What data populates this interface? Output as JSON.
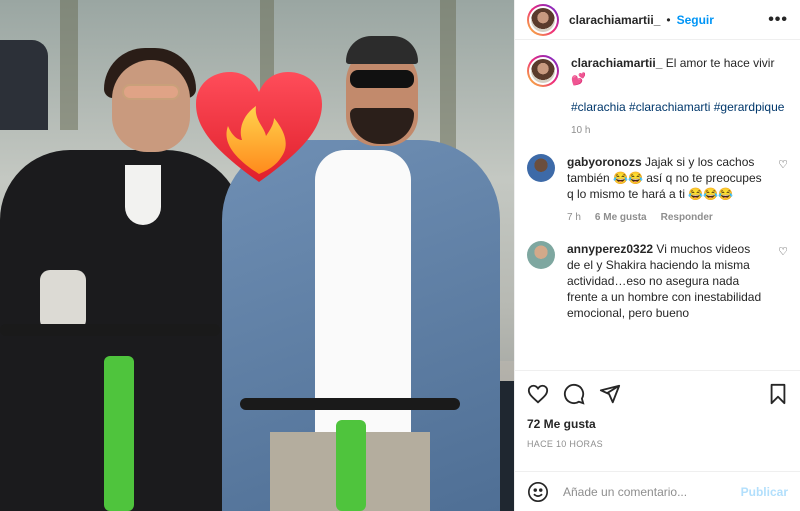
{
  "post": {
    "username": "clarachiamartii_",
    "follow_label": "Seguir",
    "more_label": "•••",
    "caption_text": "El amor te hace vivir",
    "caption_emoji": "💕",
    "hashtags": "#clarachia #clarachiamarti #gerardpique",
    "caption_time": "10 h",
    "heart_emoji_name": "heart-on-fire-icon"
  },
  "comments": [
    {
      "username": "gabyoronozs",
      "text": "Jajak si y los cachos también 😂😂 así q no te preocupes q lo mismo te hará a ti 😂😂😂",
      "time": "7 h",
      "likes": "6 Me gusta",
      "reply_label": "Responder"
    },
    {
      "username": "annyperez0322",
      "text": "Vi muchos videos de el y Shakira haciendo la misma actividad…eso no asegura nada frente a un hombre con inestabilidad emocional, pero bueno"
    }
  ],
  "stats": {
    "likes": "72 Me gusta",
    "ago": "HACE 10 HORAS"
  },
  "add_comment": {
    "placeholder": "Añade un comentario...",
    "publish_label": "Publicar"
  },
  "colors": {
    "link": "#0095f6",
    "hashtag": "#00376b",
    "muted": "#8e8e8e"
  }
}
